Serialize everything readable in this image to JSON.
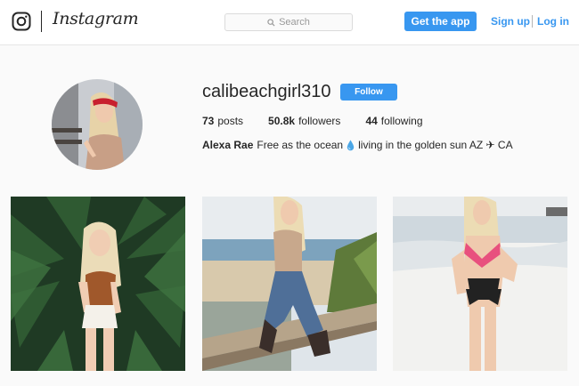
{
  "header": {
    "brand": "Instagram",
    "search": {
      "placeholder": "Search"
    },
    "get_app_label": "Get the app",
    "signup_label": "Sign up",
    "login_label": "Log in",
    "colors": {
      "accent": "#3897f0",
      "border": "#dbdbdb"
    }
  },
  "profile": {
    "username": "calibeachgirl310",
    "follow_label": "Follow",
    "stats": [
      {
        "value": "73",
        "label": "posts"
      },
      {
        "value": "50.8k",
        "label": "followers"
      },
      {
        "value": "44",
        "label": "following"
      }
    ],
    "bio": {
      "name": "Alexa Rae",
      "text_before": "Free as the ocean",
      "text_after": "living in the golden sun AZ ✈ CA",
      "icon": "water-drop-icon"
    }
  },
  "posts": [
    {
      "icon": "photo-palm-halter"
    },
    {
      "icon": "photo-pier-jeans"
    },
    {
      "icon": "photo-beach-bikini"
    }
  ]
}
